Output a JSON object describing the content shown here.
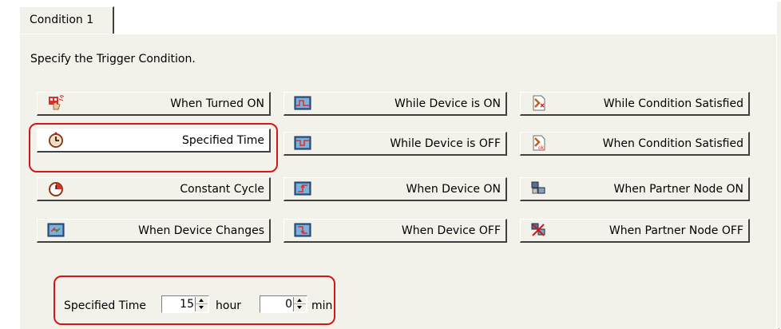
{
  "tab": {
    "label": "Condition 1"
  },
  "caption": "Specify the Trigger Condition.",
  "buttons": {
    "col1": [
      {
        "label": "When Turned ON",
        "icon": "hand-touch-icon"
      },
      {
        "label": "Specified Time",
        "icon": "clock-icon"
      },
      {
        "label": "Constant Cycle",
        "icon": "cycle-clock-icon"
      },
      {
        "label": "When Device Changes",
        "icon": "device-change-icon"
      }
    ],
    "col2": [
      {
        "label": "While Device is ON",
        "icon": "device-on-wave-icon"
      },
      {
        "label": "While Device is OFF",
        "icon": "device-off-wave-icon"
      },
      {
        "label": "When Device ON",
        "icon": "device-rise-icon"
      },
      {
        "label": "When Device OFF",
        "icon": "device-fall-icon"
      }
    ],
    "col3": [
      {
        "label": "While Condition Satisfied",
        "icon": "condition-doc-icon"
      },
      {
        "label": "When Condition Satisfied",
        "icon": "condition-ok-icon"
      },
      {
        "label": "When Partner Node ON",
        "icon": "partner-node-on-icon"
      },
      {
        "label": "When Partner Node OFF",
        "icon": "partner-node-off-icon"
      }
    ]
  },
  "specified_time": {
    "label": "Specified Time",
    "hour_value": "15",
    "hour_unit": "hour",
    "min_value": "0",
    "min_unit": "min"
  },
  "colors": {
    "highlight": "#d0181b",
    "panel": "#f3f2ea"
  }
}
